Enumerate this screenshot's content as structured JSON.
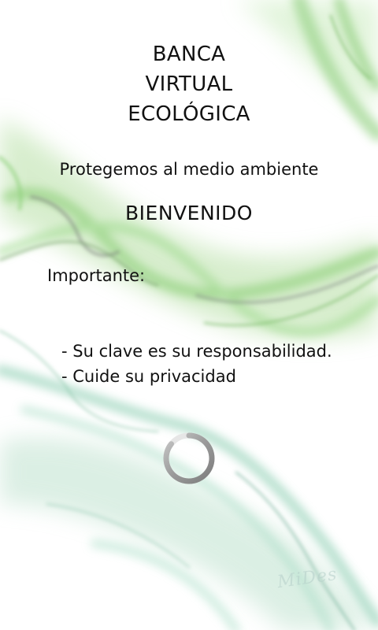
{
  "app": {
    "title_lines": [
      "BANCA",
      "VIRTUAL",
      "ECOLÓGICA"
    ],
    "subtitle": "Protegemos al medio ambiente",
    "welcome": "BIENVENIDO"
  },
  "notice": {
    "label": "Importante:",
    "items": [
      "- Su clave es su responsabilidad.",
      "- Cuide su privacidad"
    ]
  },
  "loading": {
    "icon": "loading-spinner-icon"
  },
  "background": {
    "image": "green-smoke-wallpaper",
    "watermark": "MiDes"
  },
  "colors": {
    "smoke_green": "#7fc76a",
    "smoke_teal": "#4fa58f",
    "smoke_gray": "#8a8f8c",
    "spinner": "#8d8d8d"
  }
}
